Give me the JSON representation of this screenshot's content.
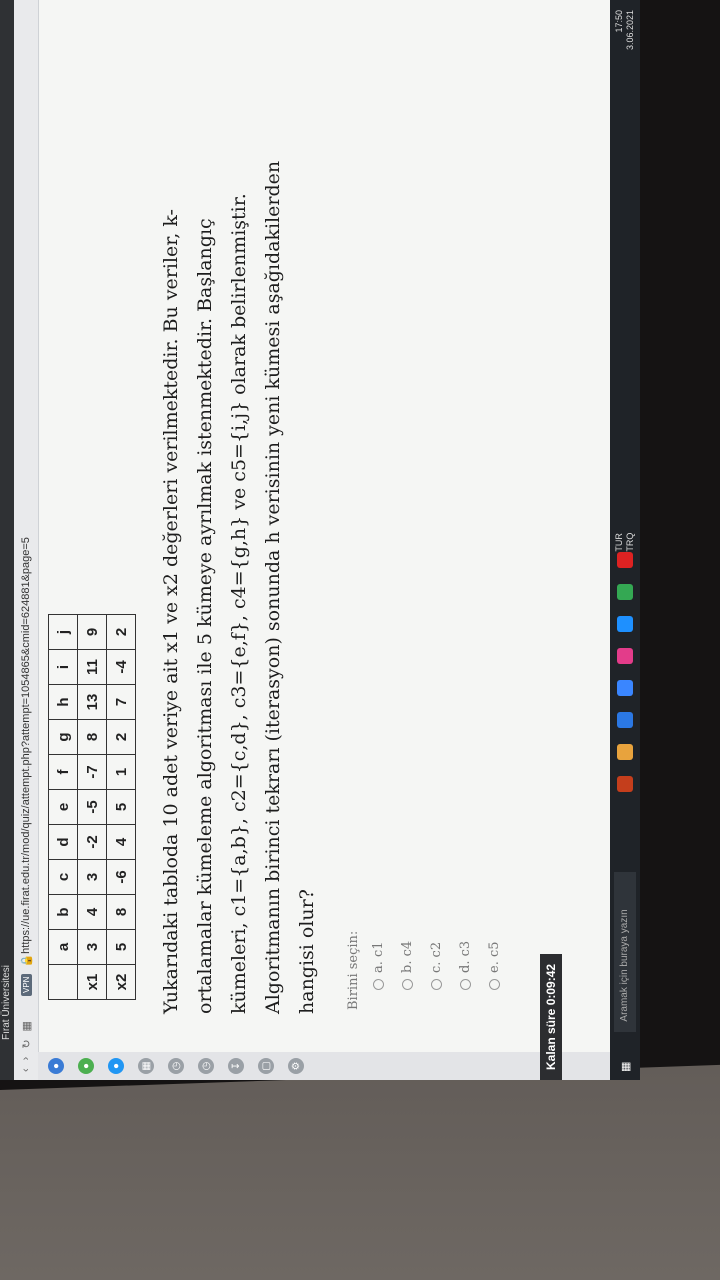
{
  "browser": {
    "tab_title": "Fırat Üniversitesi",
    "vpn_badge": "VPN",
    "url": "https://ue.firat.edu.tr/mod/quiz/attempt.php?attempt=1054865&cmid=624881&page=5"
  },
  "table": {
    "headers": [
      "",
      "a",
      "b",
      "c",
      "d",
      "e",
      "f",
      "g",
      "h",
      "i",
      "j"
    ],
    "rows": [
      [
        "x1",
        "3",
        "4",
        "3",
        "-2",
        "-5",
        "-7",
        "8",
        "13",
        "11",
        "9"
      ],
      [
        "x2",
        "5",
        "8",
        "-6",
        "4",
        "5",
        "1",
        "2",
        "7",
        "-4",
        "2"
      ]
    ]
  },
  "question": {
    "line1": "Yukarıdaki tabloda 10 adet veriye ait x1 ve x2 değerleri verilmektedir. Bu veriler, k-",
    "line2": "ortalamalar kümeleme algoritması ile 5 kümeye ayrılmak istenmektedir. Başlangıç",
    "line3": "kümeleri, c1={a,b}, c2={c,d}, c3={e,f}, c4={g,h} ve c5={i,j} olarak belirlenmiştir.",
    "line4": "Algoritmanın birinci tekrarı (iterasyon) sonunda h verisinin yeni kümesi aşağıdakilerden",
    "line5": "hangisi olur?"
  },
  "answers": {
    "prompt": "Birini seçin:",
    "options": [
      "a. c1",
      "b. c4",
      "c. c2",
      "d. c3",
      "e. c5"
    ]
  },
  "timer": {
    "label": "Kalan süre 0:09:42"
  },
  "taskbar": {
    "search_placeholder": "Aramak için buraya yazın",
    "lang1": "TUR",
    "lang2": "TRQ",
    "time": "17:50",
    "date": "3.06.2021"
  },
  "colors": {
    "page_bg": "#f5f6f4",
    "taskbar_bg": "#1f2328",
    "timer_bg": "#2c2d30"
  }
}
